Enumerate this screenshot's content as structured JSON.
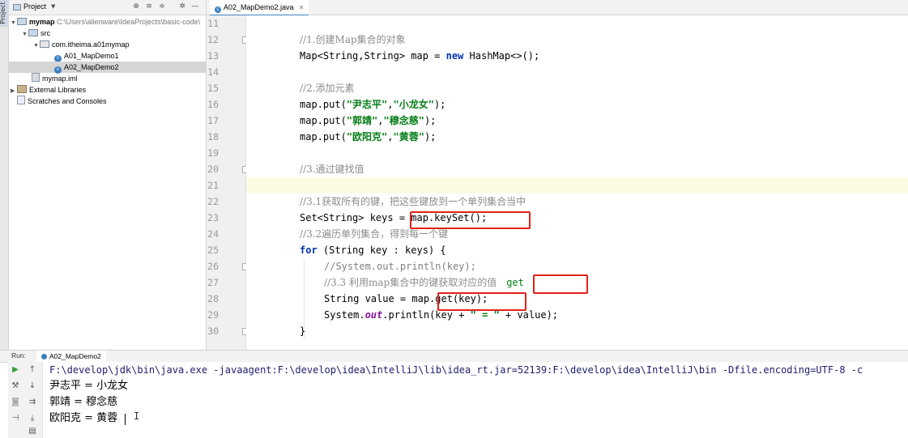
{
  "sidebar_strip": {
    "label": "Project"
  },
  "project_panel": {
    "title": "Project",
    "tree": [
      {
        "label": "mymap",
        "suffix": "C:\\Users\\alienware\\IdeaProjects\\basic-code\\",
        "kind": "module"
      },
      {
        "label": "src",
        "kind": "folder"
      },
      {
        "label": "com.itheima.a01mymap",
        "kind": "package"
      },
      {
        "label": "A01_MapDemo1",
        "kind": "class"
      },
      {
        "label": "A02_MapDemo2",
        "kind": "class",
        "selected": true
      },
      {
        "label": "mymap.iml",
        "kind": "file"
      },
      {
        "label": "External Libraries",
        "kind": "lib"
      },
      {
        "label": "Scratches and Consoles",
        "kind": "scratch"
      }
    ]
  },
  "editor": {
    "tab_label": "A02_MapDemo2.java",
    "current_line": 21,
    "line_numbers": [
      "11",
      "12",
      "13",
      "14",
      "15",
      "16",
      "17",
      "18",
      "19",
      "20",
      "21",
      "22",
      "23",
      "24",
      "25",
      "26",
      "27",
      "28",
      "29",
      "30"
    ],
    "code": {
      "c12": "//1.创建Map集合的对象",
      "l13a": "Map<String,String> map = ",
      "l13kw": "new",
      "l13b": " HashMap<>();",
      "c15": "//2.添加元素",
      "l16a": "map.put(",
      "l16s1": "\"尹志平\"",
      "l16c": ",",
      "l16s2": "\"小龙女\"",
      "l16e": ");",
      "l17a": "map.put(",
      "l17s1": "\"郭靖\"",
      "l17c": ",",
      "l17s2": "\"穆念慈\"",
      "l17e": ");",
      "l18a": "map.put(",
      "l18s1": "\"欧阳克\"",
      "l18c": ",",
      "l18s2": "\"黄蓉\"",
      "l18e": ");",
      "c20": "//3.通过键找值",
      "c22": "//3.1获取所有的键，把这些键放到一个单列集合当中",
      "l23": "Set<String> keys = map.keySet();",
      "c24": "//3.2遍历单列集合，得到每一个键",
      "l25kw": "for",
      "l25b": " (String key : keys) {",
      "c26": "//System.out.println(key);",
      "c27": "//3.3 利用map集合中的键获取对应的值",
      "c27note": "get",
      "l28": "String value = map.get(key);",
      "l29a": "System.",
      "l29f": "out",
      "l29b": ".println(key + ",
      "l29s": "\" = \"",
      "l29c": " + value);",
      "l30": "}"
    }
  },
  "run_panel": {
    "label": "Run:",
    "tab_label": "A02_MapDemo2",
    "console": [
      "F:\\develop\\jdk\\bin\\java.exe -javaagent:F:\\develop\\idea\\IntelliJ\\lib\\idea_rt.jar=52139:F:\\develop\\idea\\IntelliJ\\bin -Dfile.encoding=UTF-8 -c",
      "尹志平 = 小龙女",
      "郭靖 = 穆念慈",
      "欧阳克 = 黄蓉"
    ]
  },
  "colors": {
    "keyword": "#0033b3",
    "string": "#067d17",
    "comment": "#808080",
    "highlight_box": "#e2231a",
    "selection": "#d5d5d5"
  }
}
